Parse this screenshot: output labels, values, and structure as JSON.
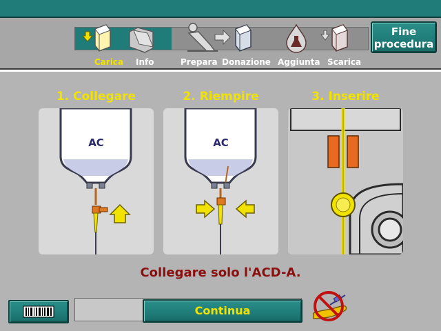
{
  "header": {
    "steps": [
      {
        "label": "Carica",
        "icon": "load-cassette-icon",
        "active": true
      },
      {
        "label": "Info",
        "icon": "folder-icon",
        "active": false
      },
      {
        "label": "Prepara",
        "icon": "patient-recline-icon",
        "active": false
      },
      {
        "label": "Donazione",
        "icon": "donation-cassette-icon",
        "active": false
      },
      {
        "label": "Aggiunta",
        "icon": "flask-drop-icon",
        "active": false
      },
      {
        "label": "Scarica",
        "icon": "unload-cassette-icon",
        "active": false
      }
    ],
    "end_button": {
      "line1": "Fine",
      "line2": "procedura"
    }
  },
  "panels": [
    {
      "title": "1. Collegare",
      "bag_label": "AC"
    },
    {
      "title": "2. Riempire",
      "bag_label": "AC"
    },
    {
      "title": "3. Inserire"
    }
  ],
  "message": "Collegare solo l'ACD-A.",
  "footer": {
    "barcode_icon": "barcode-icon",
    "continue_label": "Continua",
    "no_arm_icon": "no-arm-needle-icon"
  },
  "colors": {
    "accent": "#1f7c78",
    "highlight": "#f2e200",
    "message": "#8a1010"
  }
}
